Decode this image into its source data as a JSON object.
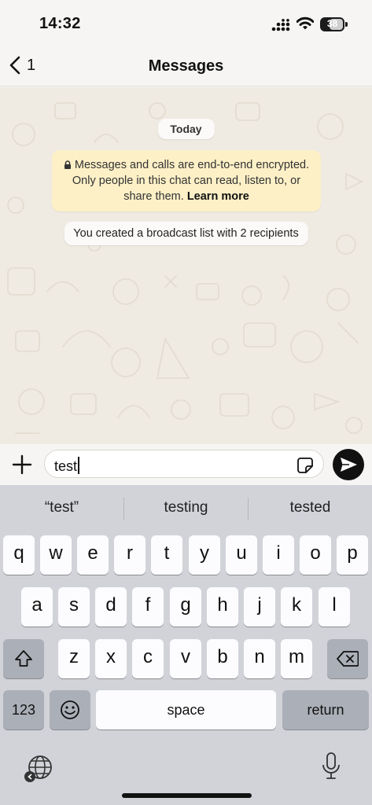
{
  "status_bar": {
    "time": "14:32",
    "battery": "38"
  },
  "header": {
    "back_count": "1",
    "title": "Messages"
  },
  "chat": {
    "date": "Today",
    "encryption_notice": "Messages and calls are end-to-end encrypted. Only people in this chat can read, listen to, or share them.",
    "learn_more": "Learn more",
    "system_message": "You created a broadcast list with 2 recipients"
  },
  "composer": {
    "text": "test"
  },
  "keyboard": {
    "suggestions": [
      "“test”",
      "testing",
      "tested"
    ],
    "row1": [
      "q",
      "w",
      "e",
      "r",
      "t",
      "y",
      "u",
      "i",
      "o",
      "p"
    ],
    "row2": [
      "a",
      "s",
      "d",
      "f",
      "g",
      "h",
      "j",
      "k",
      "l"
    ],
    "row3": [
      "z",
      "x",
      "c",
      "v",
      "b",
      "n",
      "m"
    ],
    "numbers_key": "123",
    "space_key": "space",
    "return_key": "return"
  },
  "icons": [
    "back-chevron-icon",
    "cellular-signal-icon",
    "wifi-icon",
    "battery-icon",
    "lock-icon",
    "plus-icon",
    "sticker-icon",
    "send-icon",
    "shift-icon",
    "backspace-icon",
    "emoji-icon",
    "globe-icon",
    "microphone-icon"
  ],
  "colors": {
    "chat_bg": "#efeae2",
    "encryption_bg": "#fdf0c7",
    "keyboard_bg": "#d1d3d9",
    "send_button": "#111111"
  }
}
